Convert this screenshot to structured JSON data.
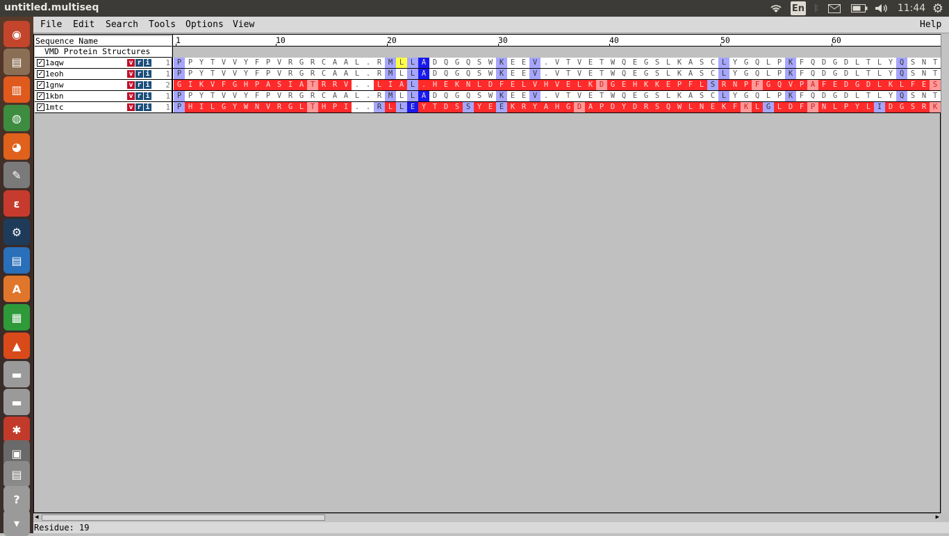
{
  "window_title": "untitled.multiseq",
  "topbar": {
    "keyboard": "En",
    "time": "11:44"
  },
  "launcher": {
    "items": [
      {
        "name": "ubuntu-dash-icon",
        "glyph": "◉",
        "color": "#c2452c"
      },
      {
        "name": "files-icon",
        "glyph": "▤",
        "color": "#8a6f55"
      },
      {
        "name": "document-viewer-icon",
        "glyph": "▥",
        "color": "#e05a1e"
      },
      {
        "name": "chrome-icon",
        "glyph": "◍",
        "color": "#3d8c40"
      },
      {
        "name": "firefox-icon",
        "glyph": "◕",
        "color": "#e0611b"
      },
      {
        "name": "text-editor-icon",
        "glyph": "✎",
        "color": "#7a7a7a"
      },
      {
        "name": "evince-icon",
        "glyph": "ε",
        "color": "#c73b2e"
      },
      {
        "name": "steam-icon",
        "glyph": "⚙",
        "color": "#1f3b5a"
      },
      {
        "name": "writer-icon",
        "glyph": "▤",
        "color": "#2a6fba"
      },
      {
        "name": "software-center-icon",
        "glyph": "A",
        "color": "#e0762c"
      },
      {
        "name": "calc-icon",
        "glyph": "▦",
        "color": "#2f9a3a"
      },
      {
        "name": "vlc-icon",
        "glyph": "▲",
        "color": "#d94a1a"
      },
      {
        "name": "drive-icon",
        "glyph": "▬",
        "color": "#9a9a9a"
      },
      {
        "name": "drive2-icon",
        "glyph": "▬",
        "color": "#9a9a9a"
      },
      {
        "name": "settings-tool-icon",
        "glyph": "✱",
        "color": "#c23a2a"
      },
      {
        "name": "monitor-icon",
        "glyph": "▣",
        "color": "#6a6a6a"
      },
      {
        "name": "printer-icon",
        "glyph": "▤",
        "color": "#8a8a8a"
      },
      {
        "name": "help-icon",
        "glyph": "?",
        "color": "#9a9a9a"
      },
      {
        "name": "trash-icon",
        "glyph": "▾",
        "color": "#9a9a9a"
      }
    ]
  },
  "menu": {
    "file": "File",
    "edit": "Edit",
    "search": "Search",
    "tools": "Tools",
    "options": "Options",
    "view": "View",
    "help": "Help"
  },
  "headers": {
    "sequence_name": "Sequence Name",
    "group": "VMD Protein Structures"
  },
  "ruler": {
    "ticks": [
      {
        "pos": 1,
        "label": "1"
      },
      {
        "pos": 10,
        "label": "10"
      },
      {
        "pos": 20,
        "label": "20"
      },
      {
        "pos": 30,
        "label": "30"
      },
      {
        "pos": 40,
        "label": "40"
      },
      {
        "pos": 50,
        "label": "50"
      },
      {
        "pos": 60,
        "label": "60"
      }
    ]
  },
  "vri": {
    "v": "v",
    "r": "r",
    "i": "i"
  },
  "colors": {
    "v_bg": "#c0102a",
    "ri_bg": "#1a4e7a",
    "light_blue": "#a6a6ff",
    "mid_blue": "#7070ff",
    "dark_blue": "#1a1aee",
    "yellow": "#ffff44",
    "red": "#ff2a2a",
    "pink": "#ff9999",
    "light_pink": "#ffcccc"
  },
  "sequences": [
    {
      "name": "1aqw",
      "start": "1",
      "residues": "PPYTVVYFPVRGRCAAL.RMLLADQGQSWKEEV.VTVETWQEGSLKASCLYGQLPKFQDGDLTLYQSNTI",
      "colors": "AWWWWWWWWWWWWWWWWWWAYADWWWWWWAWWAWWWWWWWWWWWWWWWWAWWWWWAWWWWWWWWWAWWWWWW"
    },
    {
      "name": "1eoh",
      "start": "1",
      "residues": "PPYTVVYFPVRGRCAAL.RMLLADQGQSWKEEV.VTVETWQEGSLKASCLYGQLPKFQDGDLTLYQSNTI",
      "colors": "AWWWWWWWWWWWWWWWWWWAWADWWWWWWAWWAWWWWWWWWWWWWWWWWAWWWWWAWWWWWWWWWAWWWWWW"
    },
    {
      "name": "1gnw",
      "start": "2",
      "residues": "GIKVFGHPASIATRRV..LIAL.HEKNLDFELVHVELKDGEHKKEPFLSRNPFGQVPAFEDGDLKLFESRA",
      "colors": "RRRRRRRRRRRRPRRRWWRRRARRRRRRRRRRRRRRRRPRRRRRRRRRARRRPRRRRPRRRRRRRRRRPRR"
    },
    {
      "name": "1kbn",
      "start": "1",
      "residues": "PPYTVVYFPVRGRCAAL.RMLLADQGQSWKEEV.VTVETWQEGSLKASCLYGQLPKFQDGDLTLYQSNTI",
      "colors": "AWWWWWWWWWWWWWWWWWWAWADWWWWWWAWWAWWWWWWWWWWWWWWWWAWWWWWAWWWWWWWWWAWWWWWW"
    },
    {
      "name": "1mtc",
      "start": "1",
      "residues": "PHILGYWNVRGLTHPI..RLLEYTDSSYEEKRYAHGDAPDYDRSQWLNEKFKLGLDFPNLPYLIDGSRK",
      "colors": "ARRRRRRRRRRRPRRRWWARADRRRRARRARRRRRRPRRRRRRRRRRRRRRPRARRRPRRRRRARRRRPR"
    }
  ],
  "status": "Residue: 19"
}
